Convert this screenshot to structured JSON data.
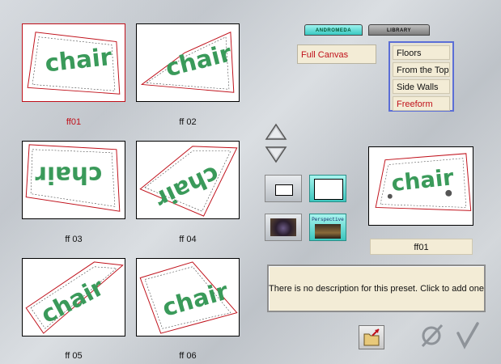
{
  "tabs": [
    {
      "label": "ANDROMEDA",
      "active": true
    },
    {
      "label": "LIBRARY",
      "active": false
    }
  ],
  "presets": [
    {
      "caption": "ff01",
      "selected": true,
      "logo": "chair"
    },
    {
      "caption": "ff 02",
      "selected": false,
      "logo": "chair"
    },
    {
      "caption": "ff 03",
      "selected": false,
      "logo": "chair"
    },
    {
      "caption": "ff 04",
      "selected": false,
      "logo": "chair"
    },
    {
      "caption": "ff 05",
      "selected": false,
      "logo": "chair"
    },
    {
      "caption": "ff 06",
      "selected": false,
      "logo": "chair"
    }
  ],
  "canvas_option": "Full Canvas",
  "category_list": {
    "items": [
      "Floors",
      "From the Top",
      "Side Walls",
      "Freeform"
    ],
    "selected": "Freeform"
  },
  "view_buttons": {
    "perspective_label": "Perspective"
  },
  "preview": {
    "logo": "chair",
    "name": "ff01"
  },
  "description": "There is no description for this preset. Click to add one",
  "icons": {
    "scroll_up": "triangle-up-icon",
    "scroll_down": "triangle-down-icon",
    "load": "folder-open-icon",
    "cancel": "cancel-slash-icon",
    "ok": "checkmark-icon"
  },
  "colors": {
    "selected_text": "#c0101a",
    "accent_logo": "#3a9a5a",
    "list_border": "#5b6ed6",
    "active_tab": "#38c9c2"
  }
}
